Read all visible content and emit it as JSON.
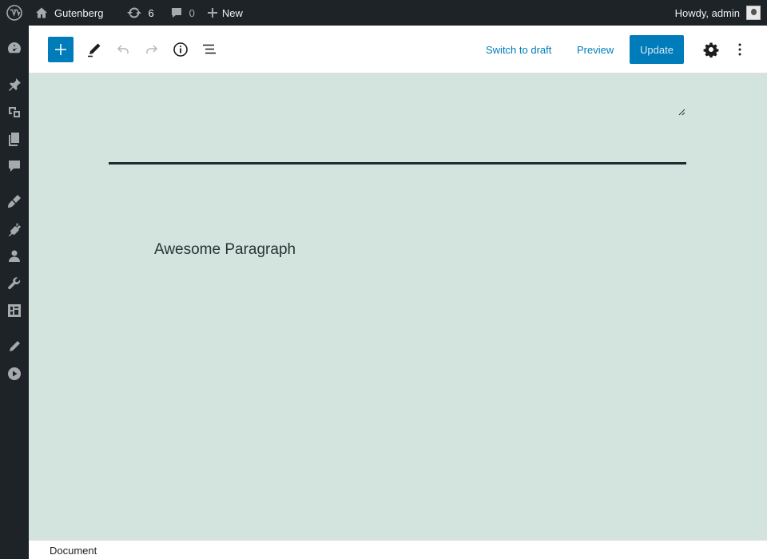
{
  "adminbar": {
    "site_name": "Gutenberg",
    "updates_count": "6",
    "comments_count": "0",
    "new_label": "New",
    "howdy": "Howdy, admin"
  },
  "sidebar_icons": [
    "dashboard-icon",
    "posts-pin-icon",
    "media-icon",
    "pages-icon",
    "comments-icon",
    "appearance-icon",
    "plugins-icon",
    "users-icon",
    "tools-icon",
    "settings-icon",
    "edit-pencil-icon",
    "play-icon"
  ],
  "header": {
    "switch_to_draft": "Switch to draft",
    "preview": "Preview",
    "update": "Update"
  },
  "content": {
    "paragraph": "Awesome Paragraph"
  },
  "footer": {
    "breadcrumb": "Document"
  },
  "colors": {
    "accent": "#007cba",
    "canvas_bg": "#d3e4de",
    "adminbar_bg": "#1d2327"
  }
}
